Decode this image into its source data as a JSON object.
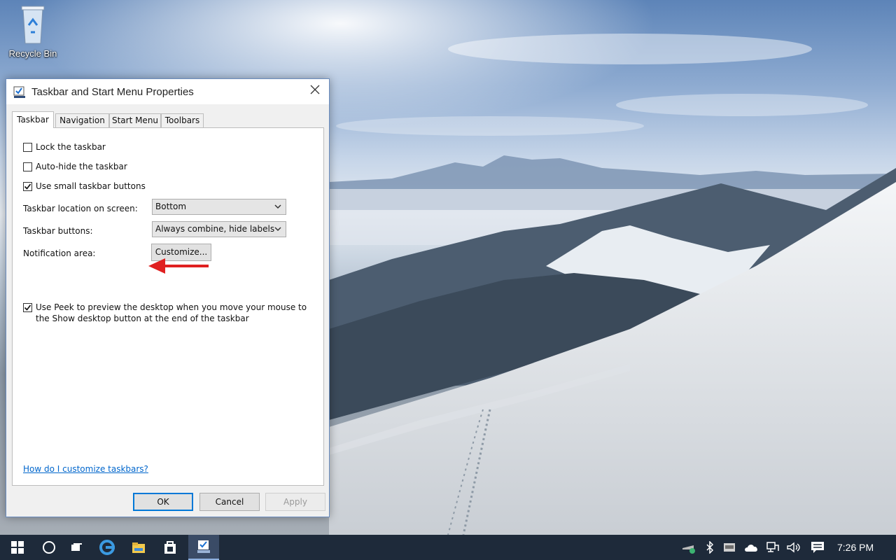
{
  "desktop": {
    "recycle_bin_label": "Recycle Bin"
  },
  "dialog": {
    "title": "Taskbar and Start Menu Properties",
    "tabs": [
      {
        "label": "Taskbar",
        "active": true
      },
      {
        "label": "Navigation",
        "active": false
      },
      {
        "label": "Start Menu",
        "active": false
      },
      {
        "label": "Toolbars",
        "active": false
      }
    ],
    "checkboxes": {
      "lock": {
        "label": "Lock the taskbar",
        "checked": false
      },
      "autohide": {
        "label": "Auto-hide the taskbar",
        "checked": false
      },
      "small_buttons": {
        "label": "Use small taskbar buttons",
        "checked": true
      }
    },
    "location": {
      "label": "Taskbar location on screen:",
      "value": "Bottom"
    },
    "buttons_setting": {
      "label": "Taskbar buttons:",
      "value": "Always combine, hide labels"
    },
    "notification": {
      "label": "Notification area:",
      "button": "Customize..."
    },
    "peek": {
      "label": "Use Peek to preview the desktop when you move your mouse to the Show desktop button at the end of the taskbar",
      "checked": true
    },
    "help_link": "How do I customize taskbars?",
    "footer": {
      "ok": "OK",
      "cancel": "Cancel",
      "apply": "Apply"
    }
  },
  "taskbar": {
    "clock": "7:26 PM",
    "apps": [
      "start-icon",
      "cortana-icon",
      "task-view-icon",
      "edge-icon",
      "file-explorer-icon",
      "store-icon",
      "taskbar-properties-icon"
    ],
    "tray_icons": [
      "network-icon",
      "bluetooth-icon",
      "vm-icon",
      "onedrive-icon",
      "ethernet-icon",
      "volume-icon",
      "action-center-icon"
    ]
  },
  "colors": {
    "accent": "#0078d7",
    "link": "#0066cc",
    "taskbar": "#1e2a3a",
    "annotation_arrow": "#e02020"
  }
}
